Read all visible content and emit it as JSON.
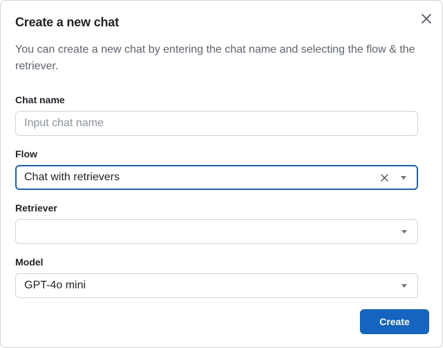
{
  "dialog": {
    "title": "Create a new chat",
    "description": "You can create a new chat by entering the chat name and selecting the flow & the retriever.",
    "close_icon": "close-icon"
  },
  "fields": {
    "chat_name": {
      "label": "Chat name",
      "value": "",
      "placeholder": "Input chat name"
    },
    "flow": {
      "label": "Flow",
      "value": "Chat with retrievers",
      "clear_icon": "clear-icon",
      "caret_icon": "caret-down-icon"
    },
    "retriever": {
      "label": "Retriever",
      "value": "",
      "caret_icon": "caret-down-icon"
    },
    "model": {
      "label": "Model",
      "value": "GPT-4o mini",
      "caret_icon": "caret-down-icon"
    }
  },
  "actions": {
    "create_label": "Create"
  },
  "colors": {
    "primary": "#1565c0",
    "border": "#cfd3d9",
    "muted_text": "#5b6470",
    "placeholder": "#8a929c"
  }
}
